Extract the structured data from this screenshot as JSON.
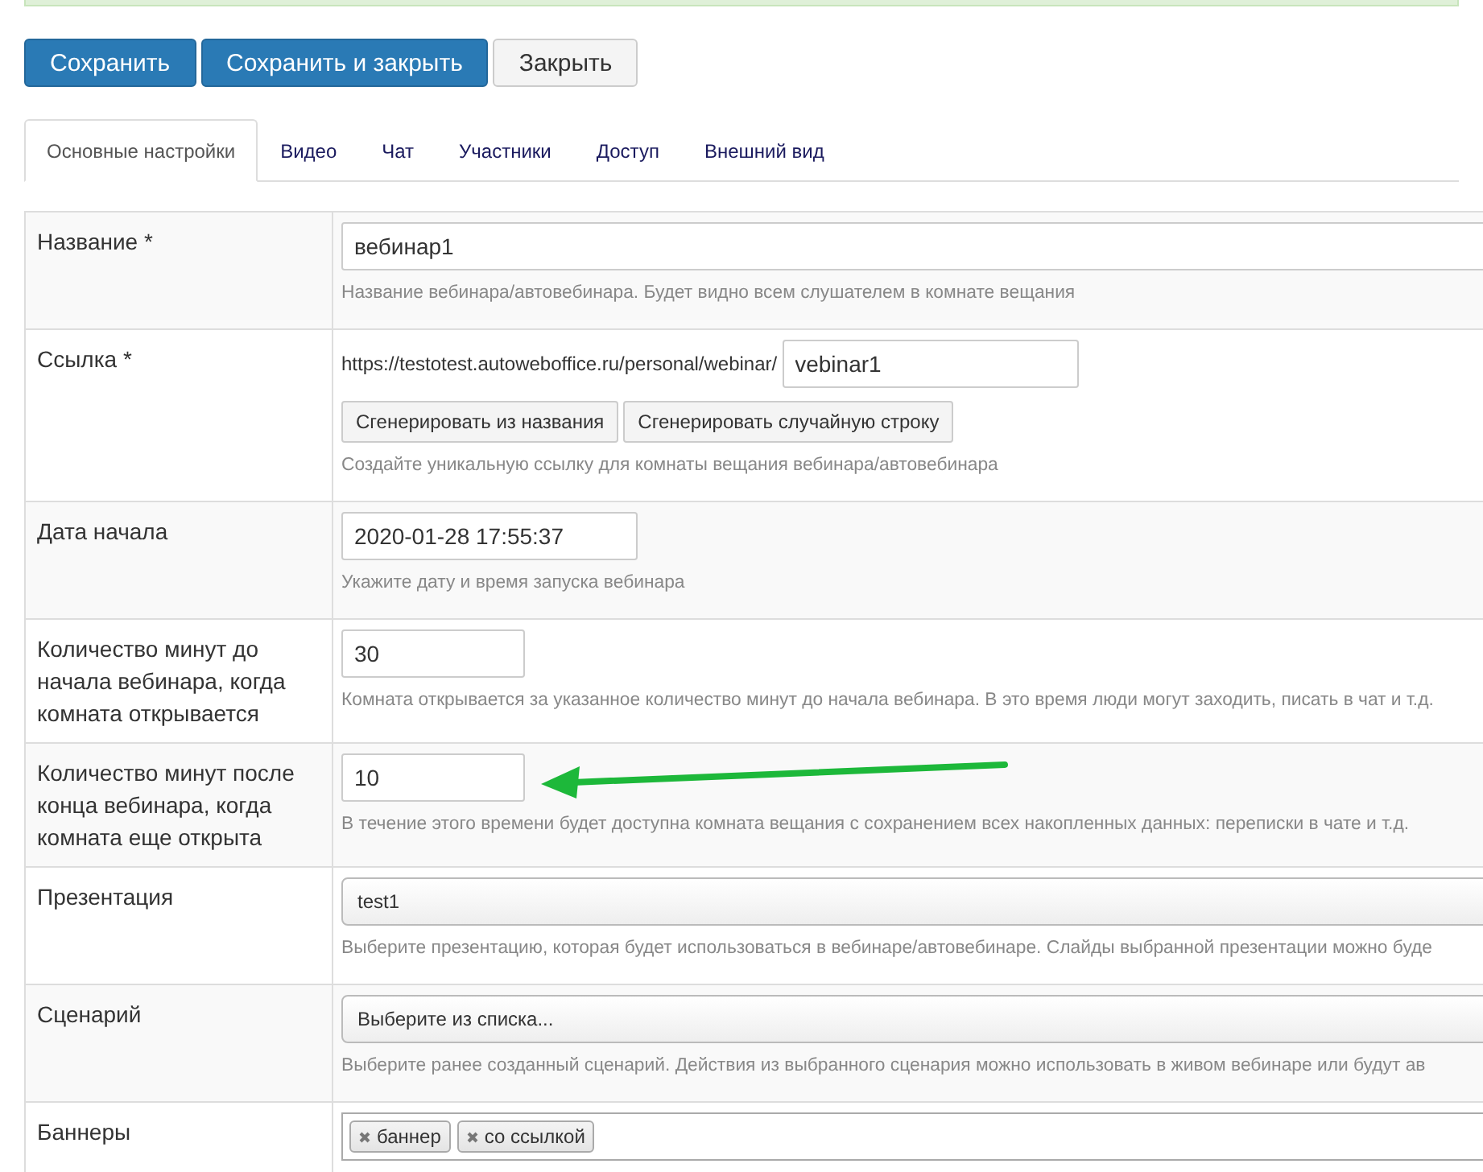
{
  "buttons": [
    {
      "label": "Сохранить",
      "kind": "primary"
    },
    {
      "label": "Сохранить и закрыть",
      "kind": "primary"
    },
    {
      "label": "Закрыть",
      "kind": "default"
    }
  ],
  "tabs": [
    {
      "label": "Основные настройки",
      "selected": true
    },
    {
      "label": "Видео",
      "selected": false
    },
    {
      "label": "Чат",
      "selected": false
    },
    {
      "label": "Участники",
      "selected": false
    },
    {
      "label": "Доступ",
      "selected": false
    },
    {
      "label": "Внешний вид",
      "selected": false
    }
  ],
  "rows": [
    {
      "label": "Название *",
      "kind": "text",
      "value": "вебинар1",
      "hint": "Название вебинара/автовебинара. Будет видно всем слушателем в комнате вещания"
    },
    {
      "label": "Ссылка *",
      "kind": "link",
      "prefix": "https://testotest.autoweboffice.ru/personal/webinar/",
      "value": "vebinar1",
      "actions": [
        "Сгенерировать из названия",
        "Сгенерировать случайную строку"
      ],
      "hint": "Создайте уникальную ссылку для комнаты вещания вебинара/автовебинара"
    },
    {
      "label": "Дата начала",
      "kind": "date",
      "value": "2020-01-28 17:55:37",
      "hint": "Укажите дату и время запуска вебинара"
    },
    {
      "label": "Количество минут до начала вебинара, когда комната открывается",
      "kind": "number",
      "value": "30",
      "hint": "Комната открывается за указанное количество минут до начала вебинара. В это время люди могут заходить, писать в чат и т.д."
    },
    {
      "label": "Количество минут после конца вебинара, когда комната еще открыта",
      "kind": "number",
      "value": "10",
      "hint": "В течение этого времени будет доступна комната вещания с сохранением всех накопленных данных: переписки в чате и т.д.",
      "arrow": true
    },
    {
      "label": "Презентация",
      "kind": "select",
      "value": "test1",
      "hint": "Выберите презентацию, которая будет использоваться в вебинаре/автовебинаре. Слайды выбранной презентации можно буде"
    },
    {
      "label": "Сценарий",
      "kind": "select",
      "value": "Выберите из списка...",
      "hint": "Выберите ранее созданный сценарий. Действия из выбранного сценария можно использовать в живом вебинаре или будут ав"
    },
    {
      "label": "Баннеры",
      "kind": "tags",
      "tags": [
        "баннер",
        "со ссылкой"
      ]
    }
  ]
}
